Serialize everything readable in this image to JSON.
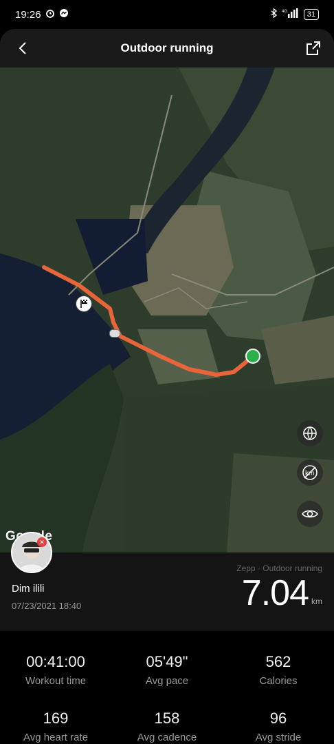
{
  "status_bar": {
    "time": "19:26",
    "battery": "31",
    "network": "4G"
  },
  "header": {
    "title": "Outdoor running",
    "back_icon": "chevron-left-icon",
    "share_icon": "share-icon"
  },
  "map": {
    "google_label": "Google",
    "controls": [
      "globe-icon",
      "km-off-icon",
      "eye-icon"
    ],
    "km_label": "km",
    "route_color": "#e8653a",
    "start_color": "#2bb04a"
  },
  "summary": {
    "user_name": "Dim ilili",
    "date": "07/23/2021 18:40",
    "source": "Zepp · Outdoor running",
    "distance": "7.04",
    "unit": "km"
  },
  "stats": [
    {
      "value": "00:41:00",
      "label": "Workout time"
    },
    {
      "value": "05'49\"",
      "label": "Avg pace"
    },
    {
      "value": "562",
      "label": "Calories"
    },
    {
      "value": "169",
      "label": "Avg heart rate"
    },
    {
      "value": "158",
      "label": "Avg cadence"
    },
    {
      "value": "96",
      "label": "Avg stride"
    }
  ]
}
